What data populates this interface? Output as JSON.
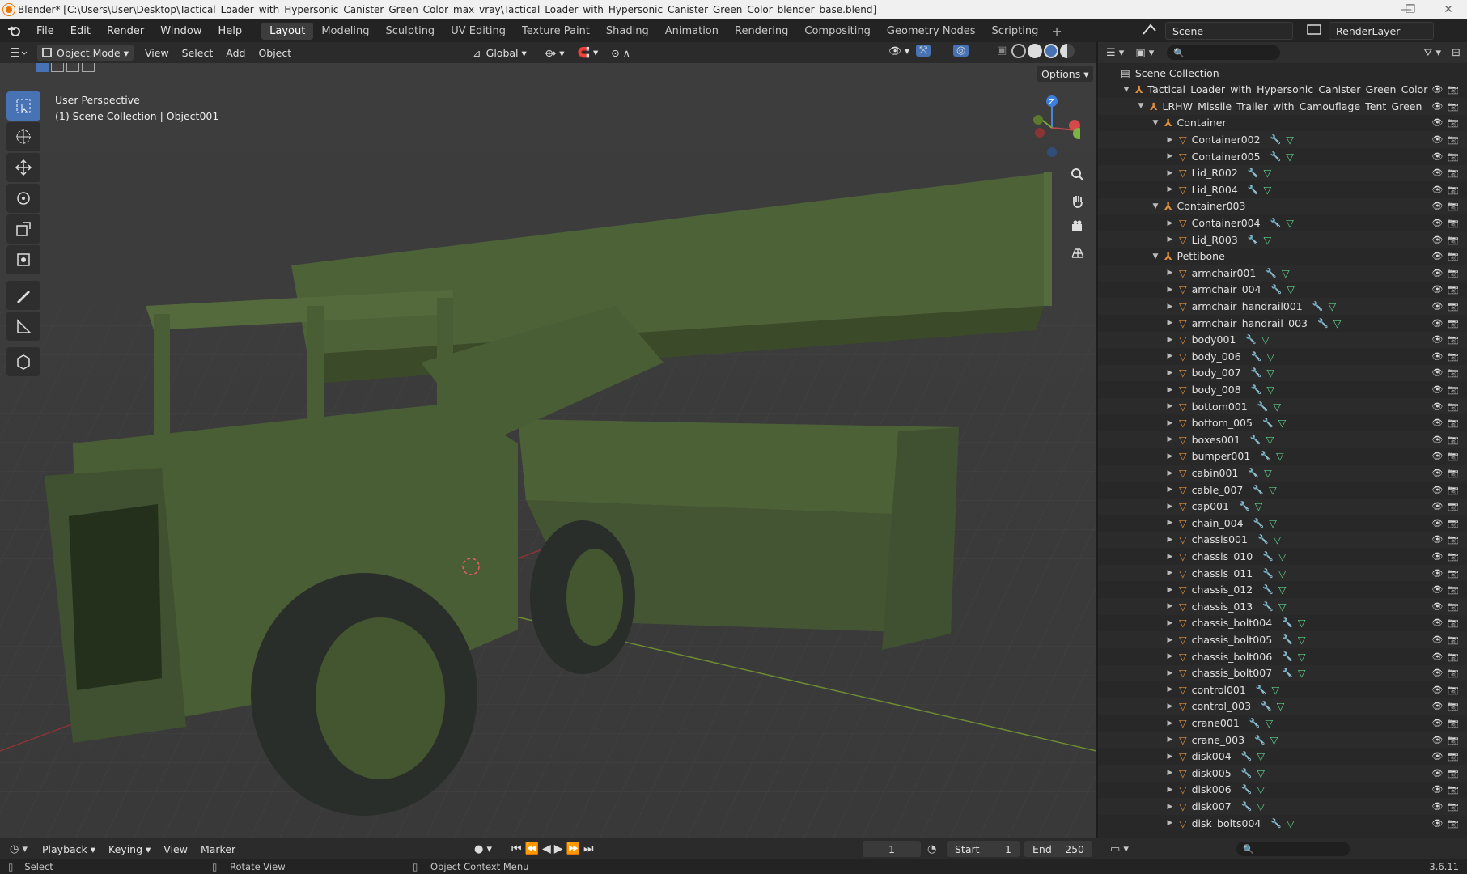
{
  "window": {
    "title": "Blender* [C:\\Users\\User\\Desktop\\Tactical_Loader_with_Hypersonic_Canister_Green_Color_max_vray\\Tactical_Loader_with_Hypersonic_Canister_Green_Color_blender_base.blend]",
    "minimize": "—",
    "maximize": "❐",
    "close": "✕"
  },
  "menu": [
    "File",
    "Edit",
    "Render",
    "Window",
    "Help"
  ],
  "workspaces": {
    "active": "Layout",
    "items": [
      "Layout",
      "Modeling",
      "Sculpting",
      "UV Editing",
      "Texture Paint",
      "Shading",
      "Animation",
      "Rendering",
      "Compositing",
      "Geometry Nodes",
      "Scripting"
    ]
  },
  "scene": {
    "name": "Scene",
    "layer": "RenderLayer"
  },
  "viewport": {
    "mode": "Object Mode",
    "menus": [
      "View",
      "Select",
      "Add",
      "Object"
    ],
    "orientation": "Global",
    "options_label": "Options",
    "overlay_perspective": "User Perspective",
    "overlay_collection": "(1) Scene Collection | Object001",
    "gizmo_z": "Z"
  },
  "outliner": {
    "root": "Scene Collection",
    "rows": [
      {
        "name": "Tactical_Loader_with_Hypersonic_Canister_Green_Color",
        "kind": "empty"
      },
      {
        "name": "LRHW_Missile_Trailer_with_Camouflage_Tent_Green",
        "kind": "empty"
      },
      {
        "name": "Container",
        "kind": "empty"
      },
      {
        "name": "Container002",
        "kind": "mesh"
      },
      {
        "name": "Container005",
        "kind": "mesh"
      },
      {
        "name": "Lid_R002",
        "kind": "mesh"
      },
      {
        "name": "Lid_R004",
        "kind": "mesh"
      },
      {
        "name": "Container003",
        "kind": "empty"
      },
      {
        "name": "Container004",
        "kind": "mesh"
      },
      {
        "name": "Lid_R003",
        "kind": "mesh"
      },
      {
        "name": "Pettibone",
        "kind": "empty"
      },
      {
        "name": "armchair001",
        "kind": "mesh"
      },
      {
        "name": "armchair_004",
        "kind": "mesh"
      },
      {
        "name": "armchair_handrail001",
        "kind": "mesh"
      },
      {
        "name": "armchair_handrail_003",
        "kind": "mesh"
      },
      {
        "name": "body001",
        "kind": "mesh"
      },
      {
        "name": "body_006",
        "kind": "mesh"
      },
      {
        "name": "body_007",
        "kind": "mesh"
      },
      {
        "name": "body_008",
        "kind": "mesh"
      },
      {
        "name": "bottom001",
        "kind": "mesh"
      },
      {
        "name": "bottom_005",
        "kind": "mesh"
      },
      {
        "name": "boxes001",
        "kind": "mesh"
      },
      {
        "name": "bumper001",
        "kind": "mesh"
      },
      {
        "name": "cabin001",
        "kind": "mesh"
      },
      {
        "name": "cable_007",
        "kind": "mesh"
      },
      {
        "name": "cap001",
        "kind": "mesh"
      },
      {
        "name": "chain_004",
        "kind": "mesh"
      },
      {
        "name": "chassis001",
        "kind": "mesh"
      },
      {
        "name": "chassis_010",
        "kind": "mesh"
      },
      {
        "name": "chassis_011",
        "kind": "mesh"
      },
      {
        "name": "chassis_012",
        "kind": "mesh"
      },
      {
        "name": "chassis_013",
        "kind": "mesh"
      },
      {
        "name": "chassis_bolt004",
        "kind": "mesh"
      },
      {
        "name": "chassis_bolt005",
        "kind": "mesh"
      },
      {
        "name": "chassis_bolt006",
        "kind": "mesh"
      },
      {
        "name": "chassis_bolt007",
        "kind": "mesh"
      },
      {
        "name": "control001",
        "kind": "mesh"
      },
      {
        "name": "control_003",
        "kind": "mesh"
      },
      {
        "name": "crane001",
        "kind": "mesh"
      },
      {
        "name": "crane_003",
        "kind": "mesh"
      },
      {
        "name": "disk004",
        "kind": "mesh"
      },
      {
        "name": "disk005",
        "kind": "mesh"
      },
      {
        "name": "disk006",
        "kind": "mesh"
      },
      {
        "name": "disk007",
        "kind": "mesh"
      },
      {
        "name": "disk_bolts004",
        "kind": "mesh"
      }
    ]
  },
  "timeline": {
    "menus": [
      "Playback",
      "Keying",
      "View",
      "Marker"
    ],
    "current_frame": "1",
    "start_label": "Start",
    "start": "1",
    "end_label": "End",
    "end": "250"
  },
  "status": {
    "select": "Select",
    "rotate": "Rotate View",
    "context": "Object Context Menu",
    "version": "3.6.11"
  },
  "colors": {
    "accent": "#4772b3",
    "object_orange": "#e08f3b",
    "modifier_blue": "#6a9bd8",
    "mesh_green": "#5fcf8a",
    "vehicle_green": "#4a5e35"
  }
}
